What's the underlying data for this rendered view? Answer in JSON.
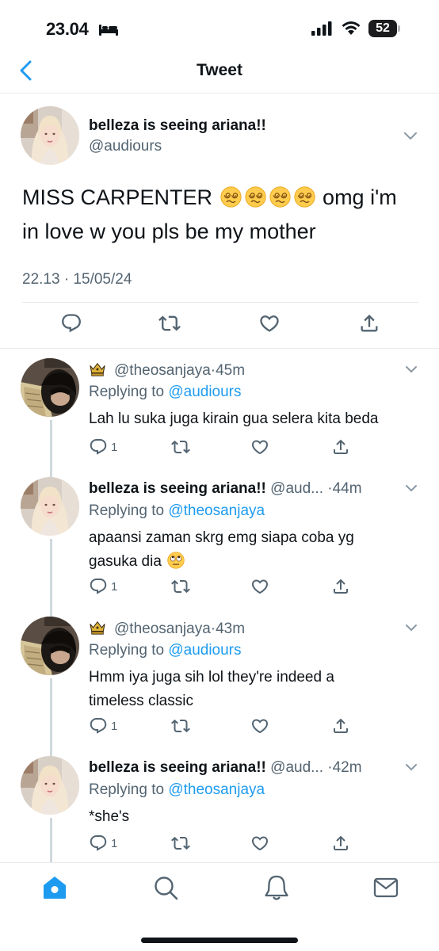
{
  "status_bar": {
    "time": "23.04",
    "battery": "52",
    "icons": [
      "sleep-bed-icon",
      "cellular-signal-icon",
      "wifi-icon",
      "battery-icon"
    ]
  },
  "nav": {
    "title": "Tweet",
    "back_icon": "chevron-left-icon"
  },
  "main_tweet": {
    "display_name": "belleza is seeing ariana!!",
    "handle": "@audiours",
    "text_before": "MISS CARPENTER ",
    "emojis": [
      "dizzy-face-emoji",
      "dizzy-face-emoji",
      "dizzy-face-emoji",
      "dizzy-face-emoji"
    ],
    "text_after": " omg i'm in love w you pls be my mother",
    "timestamp": "22.13 · 15/05/24",
    "actions": [
      "reply-icon",
      "retweet-icon",
      "like-icon",
      "share-icon"
    ]
  },
  "replies": [
    {
      "crown": true,
      "display_name": "",
      "handle": "@theosanjaya",
      "separator": "·",
      "ago": "45m",
      "replying_label": "Replying to ",
      "replying_to": "@audiours",
      "text": "Lah lu suka juga kirain gua selera kita beda",
      "reply_count": "1"
    },
    {
      "crown": false,
      "display_name": "belleza is seeing ariana!!",
      "handle": "@aud...",
      "separator": "·",
      "ago": "44m",
      "replying_label": "Replying to ",
      "replying_to": "@theosanjaya",
      "text": "apaansi zaman skrg emg siapa coba yg gasuka dia",
      "text_emoji": "eye-roll-emoji",
      "reply_count": "1"
    },
    {
      "crown": true,
      "display_name": "",
      "handle": "@theosanjaya",
      "separator": "·",
      "ago": "43m",
      "replying_label": "Replying to ",
      "replying_to": "@audiours",
      "text": "Hmm iya juga sih lol they're indeed a timeless classic",
      "reply_count": "1"
    },
    {
      "crown": false,
      "display_name": "belleza is seeing ariana!!",
      "handle": "@aud...",
      "separator": "·",
      "ago": "42m",
      "replying_label": "Replying to ",
      "replying_to": "@theosanjaya",
      "text": "*she's",
      "reply_count": "1"
    }
  ],
  "tab_bar": {
    "tabs": [
      "home-icon",
      "search-icon",
      "notifications-icon",
      "messages-icon"
    ],
    "active": "home-icon",
    "active_color": "#1d9bf0"
  },
  "colors": {
    "accent": "#1d9bf0",
    "secondary_text": "#536471",
    "divider": "#e7eaec"
  }
}
